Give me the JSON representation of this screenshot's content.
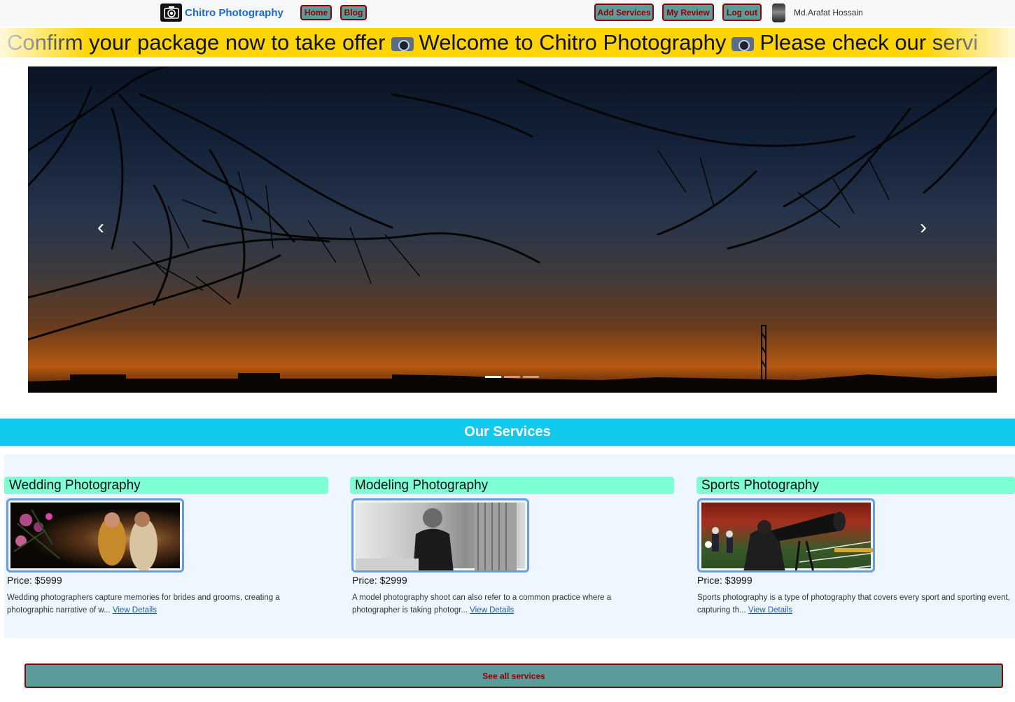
{
  "navbar": {
    "brand": "Chitro Photography",
    "links": [
      "Home",
      "Blog"
    ],
    "actions": [
      "Add Services",
      "My Review",
      "Log out"
    ],
    "user_name": "Md.Arafat Hossain"
  },
  "marquee": {
    "part1": "Confirm your package now to take offer",
    "part2": "Welcome to Chitro Photography",
    "part3": "Please check our servi"
  },
  "carousel": {
    "prev_icon": "chevron-left-icon",
    "next_icon": "chevron-right-icon",
    "slide_count": 3,
    "active_slide": 1
  },
  "services": {
    "title": "Our Services",
    "link_label": "View Details",
    "items": [
      {
        "title": "Wedding Photography",
        "price": "Price: $5999",
        "desc": "Wedding photographers capture memories for brides and grooms, creating a photographic narrative of w..."
      },
      {
        "title": "Modeling Photography",
        "price": "Price: $2999",
        "desc": "A model photography shoot can also refer to a common practice where a photographer is taking photogr..."
      },
      {
        "title": "Sports Photography",
        "price": "Price: $3999",
        "desc": "Sports photography is a type of photography that covers every sport and sporting event, capturing th..."
      }
    ],
    "see_all": "See all services"
  }
}
